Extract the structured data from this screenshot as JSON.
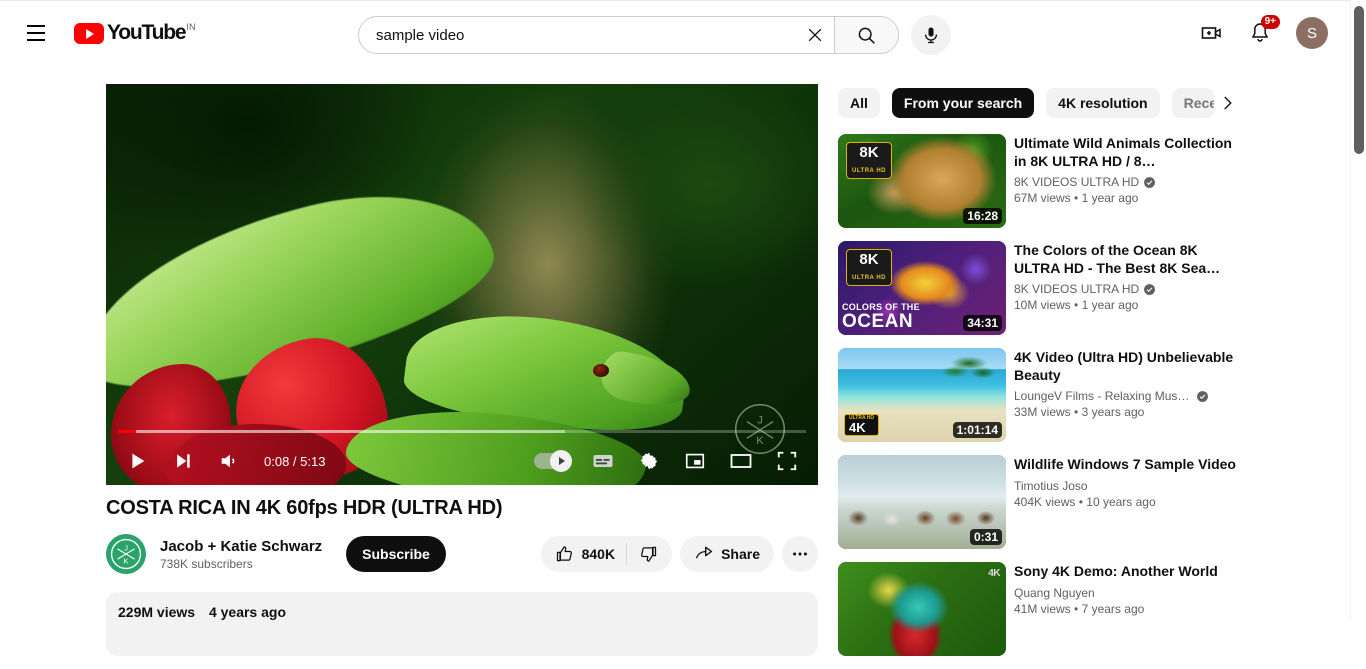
{
  "header": {
    "menu_label": "Guide menu",
    "logo_text": "YouTube",
    "country_code": "IN",
    "search": {
      "value": "sample video",
      "placeholder": "Search",
      "clear_label": "Clear search query",
      "submit_label": "Search",
      "voice_label": "Search with your voice"
    },
    "create_label": "Create",
    "notifications_label": "Notifications",
    "notification_count": "9+",
    "account_initial": "S"
  },
  "player": {
    "current_time": "0:08",
    "duration": "5:13",
    "time_display": "0:08 / 5:13",
    "progress_percent": 2.6,
    "buffer_percent": 65,
    "play_label": "Play",
    "next_label": "Next",
    "volume_label": "Mute",
    "autoplay_label": "Autoplay is on",
    "subtitles_label": "Subtitles/closed captions",
    "settings_label": "Settings",
    "miniplayer_label": "Miniplayer",
    "theater_label": "Theater mode",
    "fullscreen_label": "Full screen",
    "watermark_label": "channel-watermark"
  },
  "video": {
    "title": "COSTA RICA IN 4K 60fps HDR (ULTRA HD)",
    "channel_name": "Jacob + Katie Schwarz",
    "channel_initials": "JK",
    "subscribers": "738K subscribers",
    "subscribe_label": "Subscribe",
    "like_count": "840K",
    "dislike_label": "Dislike",
    "share_label": "Share",
    "more_label": "More actions",
    "views": "229M views",
    "published": "4 years ago"
  },
  "sidebar": {
    "chips": [
      {
        "label": "All",
        "active": false
      },
      {
        "label": "From your search",
        "active": true
      },
      {
        "label": "4K resolution",
        "active": false
      },
      {
        "label": "Rece",
        "active": false,
        "clipped": true
      }
    ],
    "chip_next_label": "Next filters",
    "videos": [
      {
        "title": "Ultimate Wild Animals Collection in 8K ULTRA HD / 8…",
        "channel": "8K VIDEOS ULTRA HD",
        "verified": true,
        "views": "67M views",
        "age": "1 year ago",
        "duration": "16:28",
        "badge": "8K",
        "badge_sub": "ULTRA HD",
        "art": "art-leopard"
      },
      {
        "title": "The Colors of the Ocean 8K ULTRA HD - The Best 8K Sea…",
        "channel": "8K VIDEOS ULTRA HD",
        "verified": true,
        "views": "10M views",
        "age": "1 year ago",
        "duration": "34:31",
        "badge": "8K",
        "badge_sub": "ULTRA HD",
        "overlay_line1": "COLORS OF THE",
        "overlay_line2": "OCEAN",
        "art": "art-fish"
      },
      {
        "title": "4K Video (Ultra HD) Unbelievable Beauty",
        "channel": "LoungeV Films - Relaxing Musi…",
        "verified": true,
        "views": "33M views",
        "age": "3 years ago",
        "duration": "1:01:14",
        "badge_4k": "4K",
        "badge_4k_sub": "ULTRA HD",
        "art": "art-beach"
      },
      {
        "title": "Wildlife Windows 7 Sample Video",
        "channel": "Timotius Joso",
        "verified": false,
        "views": "404K views",
        "age": "10 years ago",
        "duration": "0:31",
        "art": "art-horses"
      },
      {
        "title": "Sony 4K Demo: Another World",
        "channel": "Quang Nguyen",
        "verified": false,
        "views": "41M views",
        "age": "7 years ago",
        "duration": "",
        "corner_4k": "4K",
        "art": "art-chameleon"
      }
    ]
  },
  "colors": {
    "brand_red": "#ff0000",
    "badge_red": "#cc0000",
    "chip_active_bg": "#0f0f0f",
    "avatar_bg": "#8d6e63",
    "channel_avatar_bg": "#2aa36b"
  },
  "scrollbar": {
    "label": "page-scrollbar"
  }
}
